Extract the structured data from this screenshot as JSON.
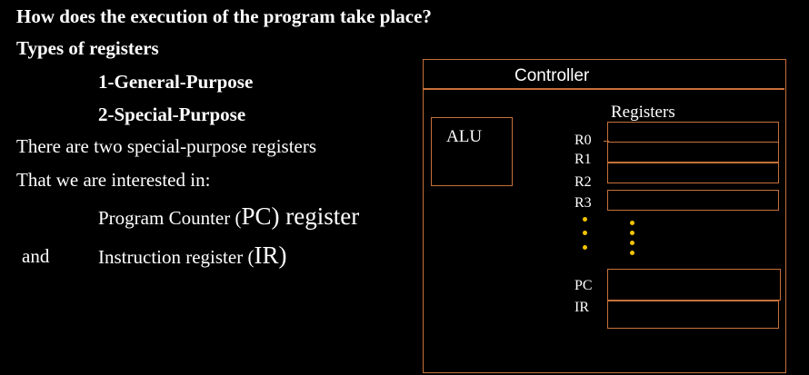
{
  "text": {
    "question": "How does the execution of the program take place?",
    "types_heading": "Types of registers",
    "general_purpose": "1-General-Purpose",
    "special_purpose": "2-Special-Purpose",
    "line1": "There are two special-purpose registers",
    "line2": "That we are interested in:",
    "pc_prefix": "Program Counter (",
    "pc_abbr": "PC",
    "pc_suffix": ") register",
    "and": "and",
    "ir_prefix": "Instruction register (",
    "ir_abbr": "IR",
    "ir_suffix": ")"
  },
  "diagram": {
    "controller_label": "Controller",
    "alu_label": "ALU",
    "registers_title": "Registers",
    "register_labels": [
      "R0",
      "R1",
      "R2",
      "R3",
      "PC",
      "IR"
    ],
    "border_color": "#c8703a",
    "dot_color": "#f2c400"
  }
}
